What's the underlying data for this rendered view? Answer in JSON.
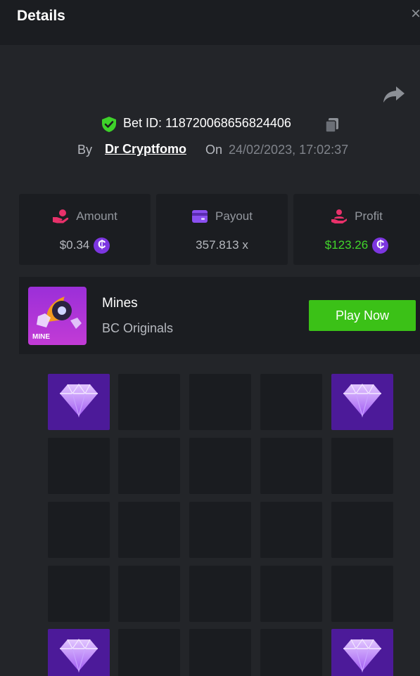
{
  "header": {
    "title": "Details",
    "close": "×"
  },
  "bet": {
    "id_label": "Bet ID: 118720068656824406",
    "by_label": "By",
    "user": "Dr Cryptfomo",
    "on_label": "On",
    "datetime": "24/02/2023, 17:02:37"
  },
  "stats": {
    "amount": {
      "label": "Amount",
      "value": "$0.34",
      "coin": "₵",
      "icon": "hand-coin-icon"
    },
    "payout": {
      "label": "Payout",
      "value": "357.813 x",
      "icon": "wallet-card-icon"
    },
    "profit": {
      "label": "Profit",
      "value": "$123.26",
      "coin": "₵",
      "icon": "hand-person-icon"
    }
  },
  "game": {
    "name": "Mines",
    "provider": "BC Originals",
    "play_label": "Play Now",
    "thumb_text": "MINE"
  },
  "colors": {
    "accent_green": "#3bc117",
    "profit_green": "#42d62b",
    "gem_tile": "#4c1a99",
    "shield_green": "#3ed22a",
    "coin_purple": "#7c36e0"
  },
  "grid": {
    "rows": [
      [
        "gem",
        "empty",
        "empty",
        "empty",
        "gem"
      ],
      [
        "empty",
        "empty",
        "empty",
        "empty",
        "empty"
      ],
      [
        "empty",
        "empty",
        "empty",
        "empty",
        "empty"
      ],
      [
        "empty",
        "empty",
        "empty",
        "empty",
        "empty"
      ],
      [
        "gem",
        "empty",
        "empty",
        "empty",
        "gem"
      ]
    ]
  }
}
